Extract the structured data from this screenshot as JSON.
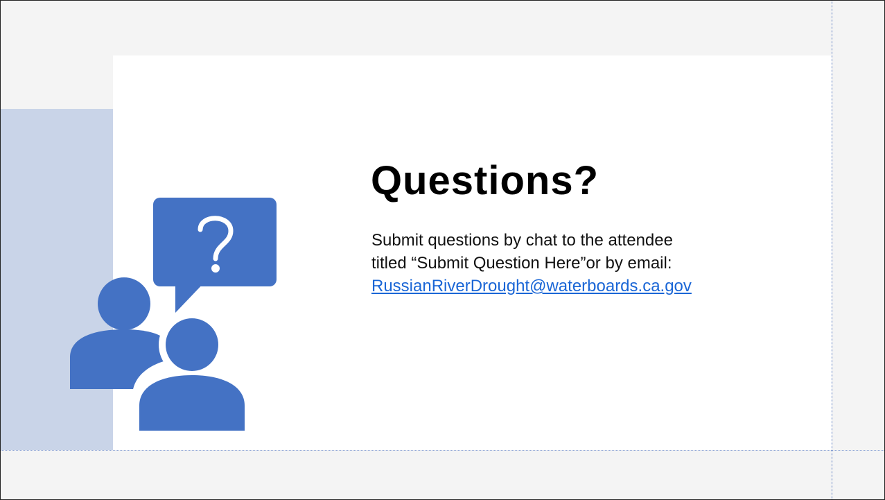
{
  "slide": {
    "title": "Questions?",
    "body_line_1": "Submit questions by chat to the attendee",
    "body_line_2": "titled “Submit Question Here”or by email:",
    "email": "RussianRiverDrought@waterboards.ca.gov"
  },
  "illustration": {
    "icon": "people-question-icon",
    "color": "#4472c4"
  },
  "colors": {
    "background": "#f4f4f4",
    "panel": "#ffffff",
    "accent_block": "#c9d4e8",
    "link": "#1a66d6"
  }
}
